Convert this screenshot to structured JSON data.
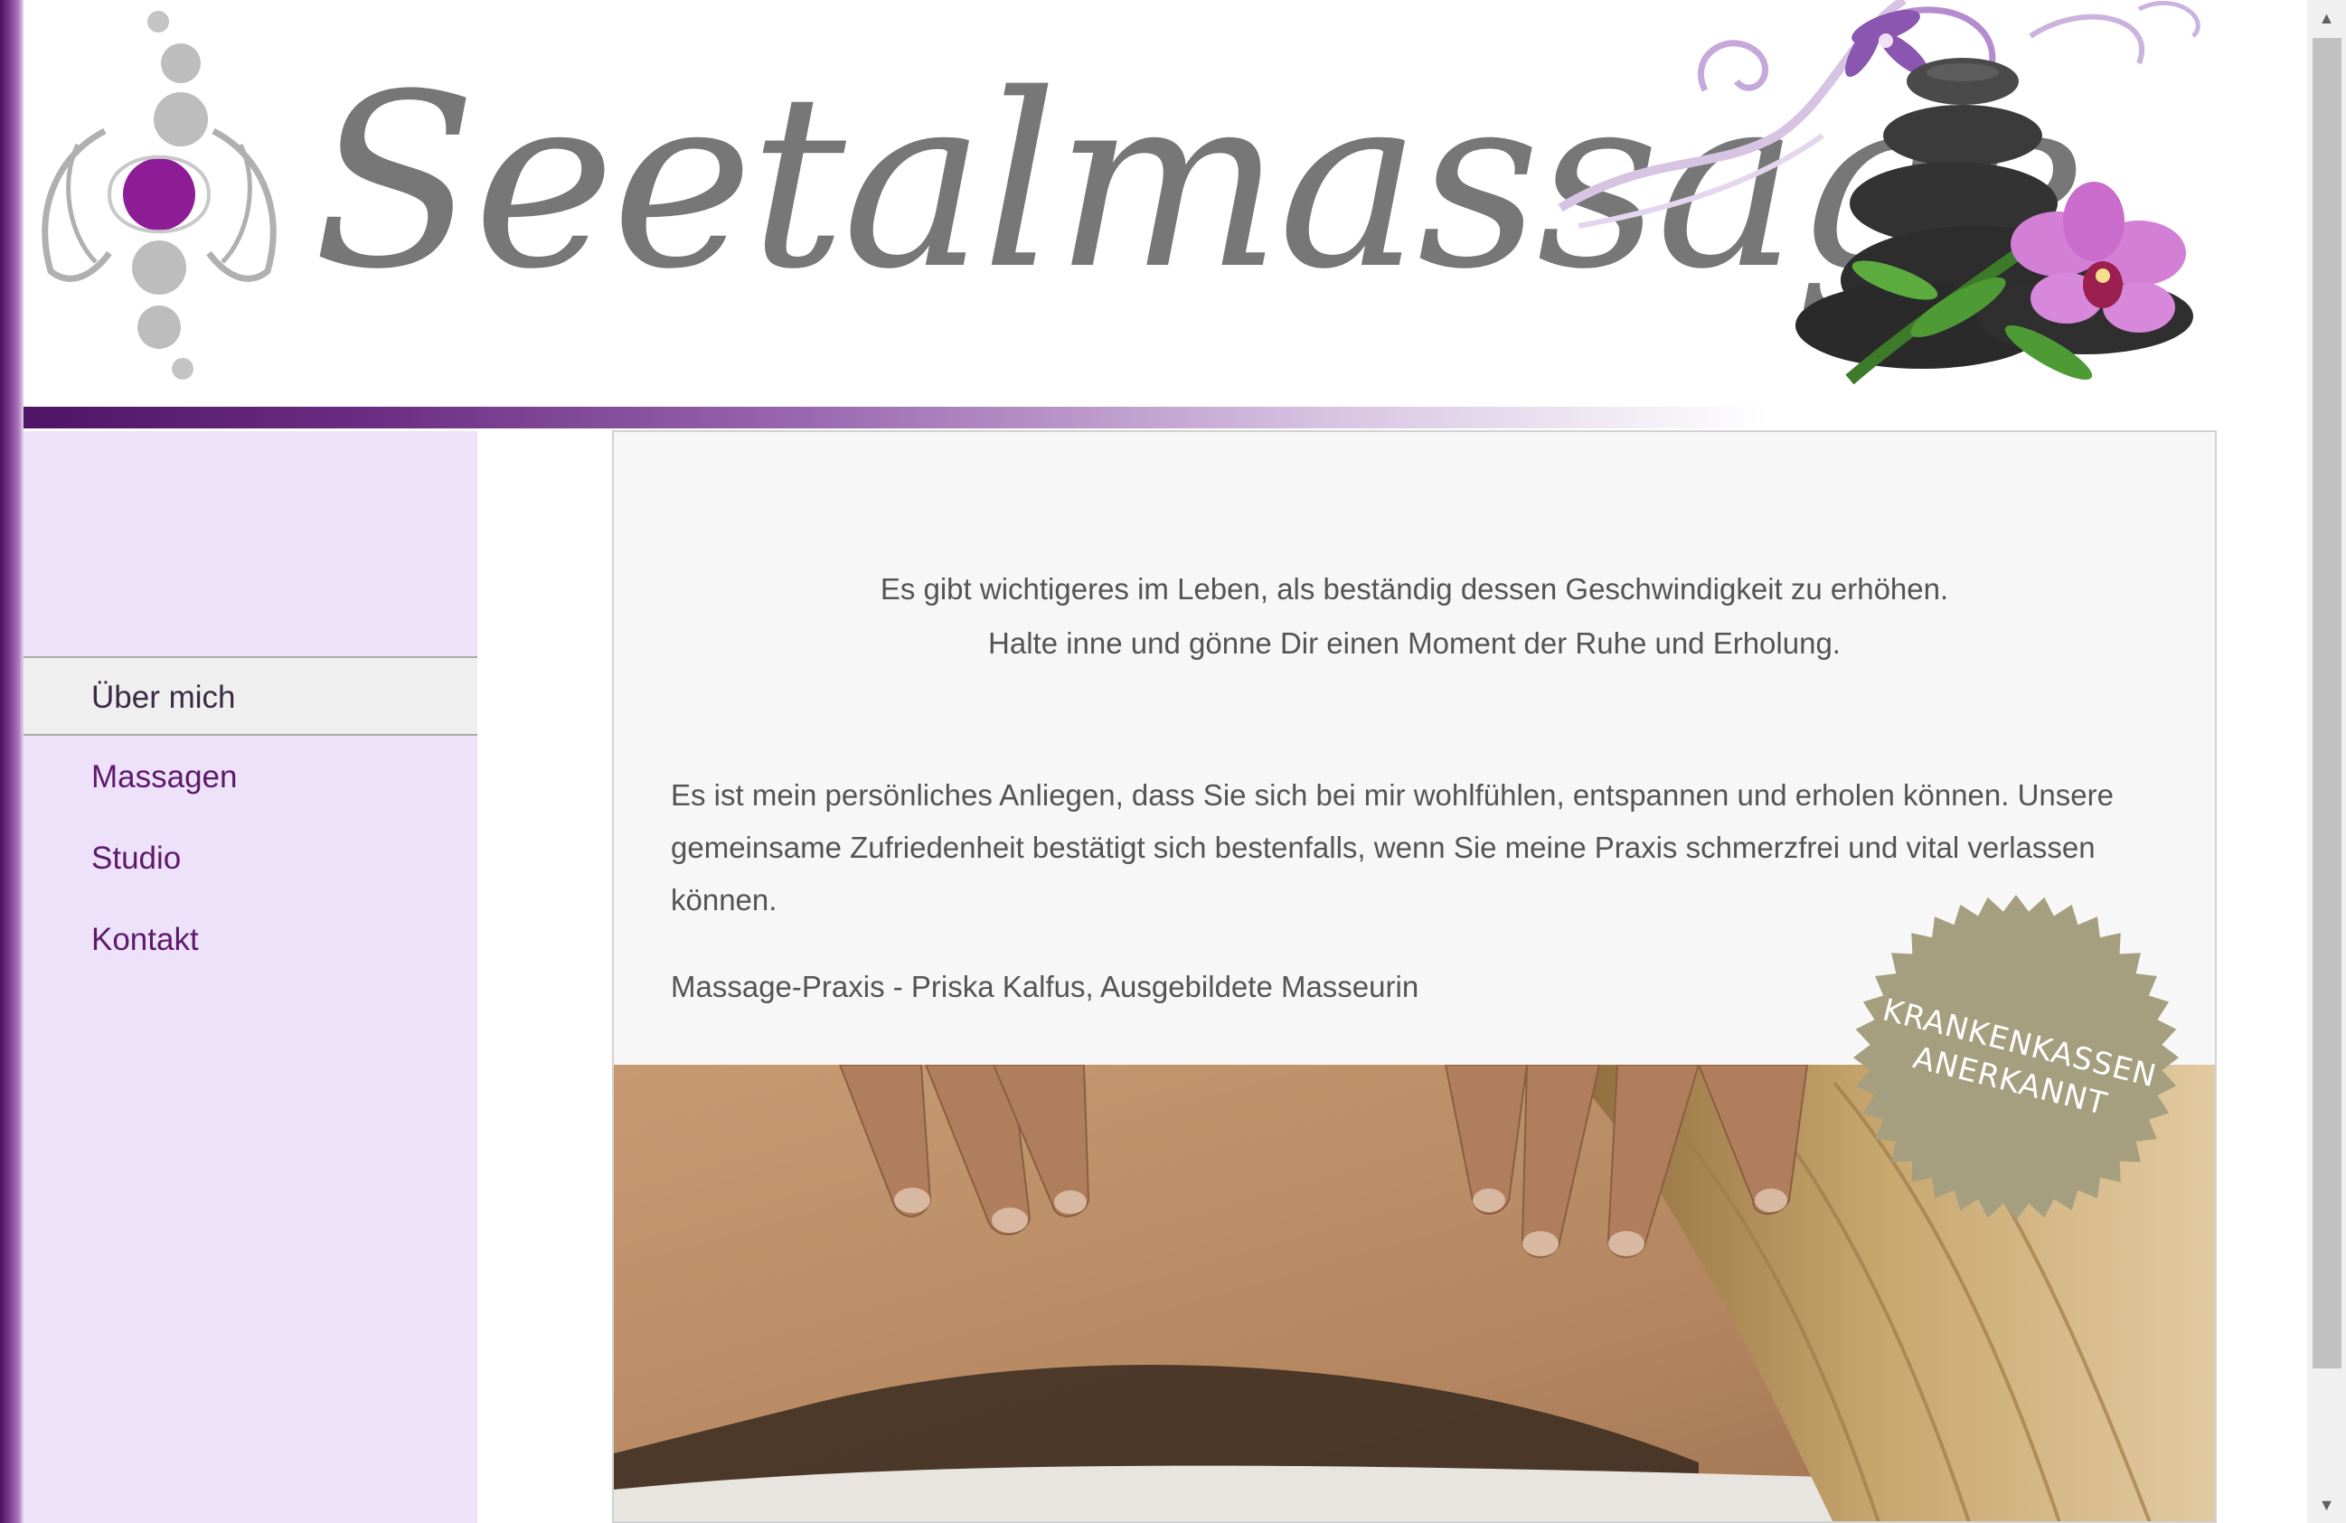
{
  "header": {
    "brand_name": "Seetalmassage",
    "logo_icon": "chakra-hands-logo",
    "decoration_icon": "stones-orchid-decoration"
  },
  "nav": {
    "items": [
      {
        "label": "Über mich",
        "active": true
      },
      {
        "label": "Massagen",
        "active": false
      },
      {
        "label": "Studio",
        "active": false
      },
      {
        "label": "Kontakt",
        "active": false
      }
    ]
  },
  "main": {
    "quote_line1": "Es gibt wichtigeres im Leben, als beständig dessen Geschwindigkeit zu erhöhen.",
    "quote_line2": "Halte inne und gönne Dir einen Moment der Ruhe und Erholung.",
    "intro": "Es ist mein persönliches Anliegen, dass Sie sich bei mir wohlfühlen, entspannen und erholen können. Unsere gemeinsame Zufriedenheit bestätigt sich bestenfalls, wenn Sie meine Praxis schmerzfrei und vital verlassen können.",
    "signature": "Massage-Praxis - Priska Kalfus, Ausgebildete Masseurin"
  },
  "badge": {
    "line1": "KRANKENKASSEN",
    "line2": "ANERKANNT"
  },
  "colors": {
    "accent": "#5e1a6a",
    "sidebar_bg": "#ede2fa",
    "badge": "#a59f7f",
    "text": "#545454"
  }
}
